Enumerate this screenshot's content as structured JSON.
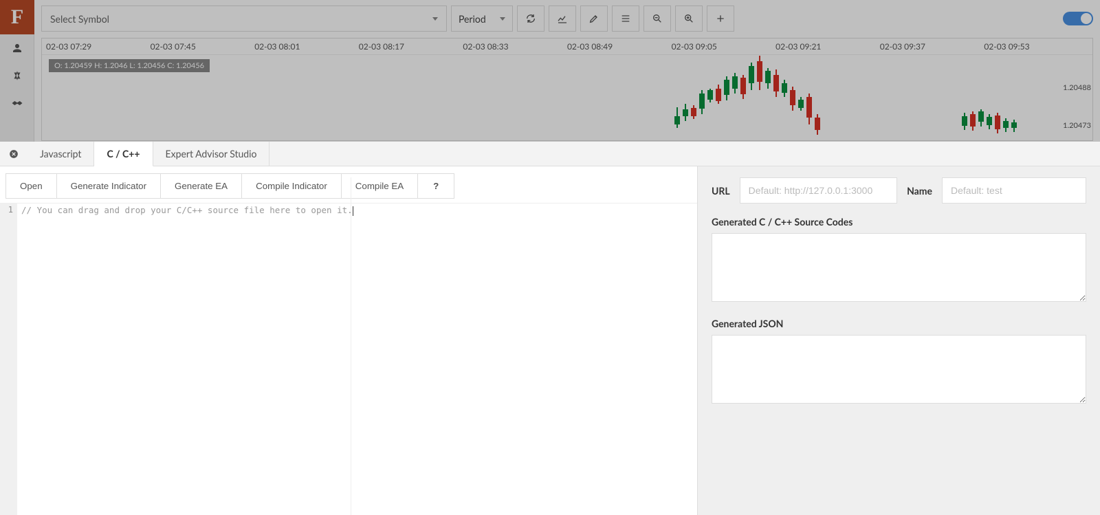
{
  "logo": "F",
  "toolbar": {
    "symbol_placeholder": "Select Symbol",
    "period_label": "Period"
  },
  "chart": {
    "time_ticks": [
      "02-03 07:29",
      "02-03 07:45",
      "02-03 08:01",
      "02-03 08:17",
      "02-03 08:33",
      "02-03 08:49",
      "02-03 09:05",
      "02-03 09:21",
      "02-03 09:37",
      "02-03 09:53"
    ],
    "ohlc": "O: 1.20459 H: 1.2046 L: 1.20456 C: 1.20456",
    "price_labels": [
      "1.20488",
      "1.20473"
    ]
  },
  "tabs": {
    "javascript": "Javascript",
    "ccpp": "C / C++",
    "eas": "Expert Advisor Studio"
  },
  "actions": {
    "open": "Open",
    "gen_indicator": "Generate Indicator",
    "gen_ea": "Generate EA",
    "compile_indicator": "Compile Indicator",
    "compile_ea": "Compile EA",
    "help": "?"
  },
  "editor": {
    "line1_num": "1",
    "line1": "// You can drag and drop your C/C++ source file here to open it."
  },
  "right": {
    "url_label": "URL",
    "url_placeholder": "Default: http://127.0.0.1:3000",
    "name_label": "Name",
    "name_placeholder": "Default: test",
    "src_label": "Generated C / C++ Source Codes",
    "json_label": "Generated JSON"
  }
}
